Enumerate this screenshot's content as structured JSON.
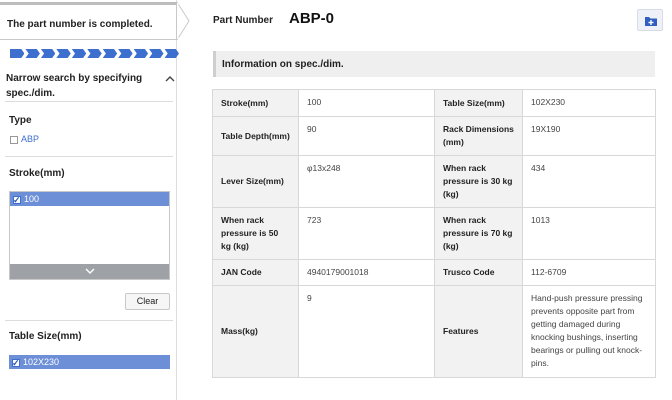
{
  "status": {
    "completed_message": "The part number is completed."
  },
  "progress": {
    "steps": 11
  },
  "sidebar": {
    "narrow_heading": "Narrow search by specifying spec./dim.",
    "collapse_icon": "chevron-up-icon",
    "type": {
      "title": "Type",
      "option": "ABP",
      "checked": false
    },
    "stroke": {
      "title": "Stroke(mm)",
      "selected_option": "100",
      "expand_icon": "chevron-down-icon"
    },
    "clear_label": "Clear",
    "table_size": {
      "title": "Table Size(mm)",
      "selected_option": "102X230"
    }
  },
  "header": {
    "part_number_label": "Part Number",
    "part_number_value": "ABP-0",
    "add_icon": "folder-plus-icon"
  },
  "section_title": "Information on spec./dim.",
  "specs": [
    {
      "label1": "Stroke(mm)",
      "value1": "100",
      "label2": "Table Size(mm)",
      "value2": "102X230"
    },
    {
      "label1": "Table Depth(mm)",
      "value1": "90",
      "label2": "Rack Dimensions (mm)",
      "value2": "19X190"
    },
    {
      "label1": "Lever Size(mm)",
      "value1": "φ13x248",
      "label2": "When rack pressure is 30 kg (kg)",
      "value2": "434"
    },
    {
      "label1": "When rack pressure is 50 kg (kg)",
      "value1": "723",
      "label2": "When rack pressure is 70 kg (kg)",
      "value2": "1013"
    },
    {
      "label1": "JAN Code",
      "value1": "4940179001018",
      "label2": "Trusco Code",
      "value2": "112-6709"
    },
    {
      "label1": "Mass(kg)",
      "value1": "9",
      "label2": "Features",
      "value2": "Hand-push pressure pressing prevents opposite part from getting damaged during knocking bushings, inserting bearings or pulling out knock-pins."
    }
  ],
  "colors": {
    "accent": "#3d6fcf",
    "selected_bg": "#6c8fd8",
    "header_bg": "#f2f2f2"
  }
}
